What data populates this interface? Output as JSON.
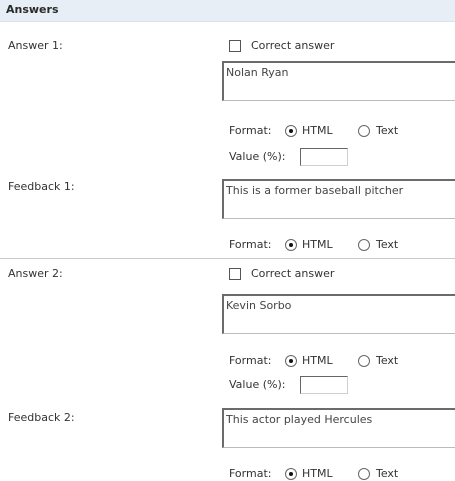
{
  "section": {
    "title": "Answers"
  },
  "common": {
    "correct_label": "Correct answer",
    "format_label": "Format:",
    "html_label": "HTML",
    "text_label": "Text",
    "value_label": "Value (%):",
    "value_input": ""
  },
  "answers": [
    {
      "answer_label": "Answer 1:",
      "answer_text": "Nolan Ryan",
      "feedback_label": "Feedback 1:",
      "feedback_text": "This is a former baseball pitcher"
    },
    {
      "answer_label": "Answer 2:",
      "answer_text": "Kevin Sorbo",
      "feedback_label": "Feedback 2:",
      "feedback_text": "This actor played Hercules"
    }
  ],
  "states": {
    "correct_checked": false,
    "answer_format": "HTML",
    "feedback_format": "HTML"
  }
}
